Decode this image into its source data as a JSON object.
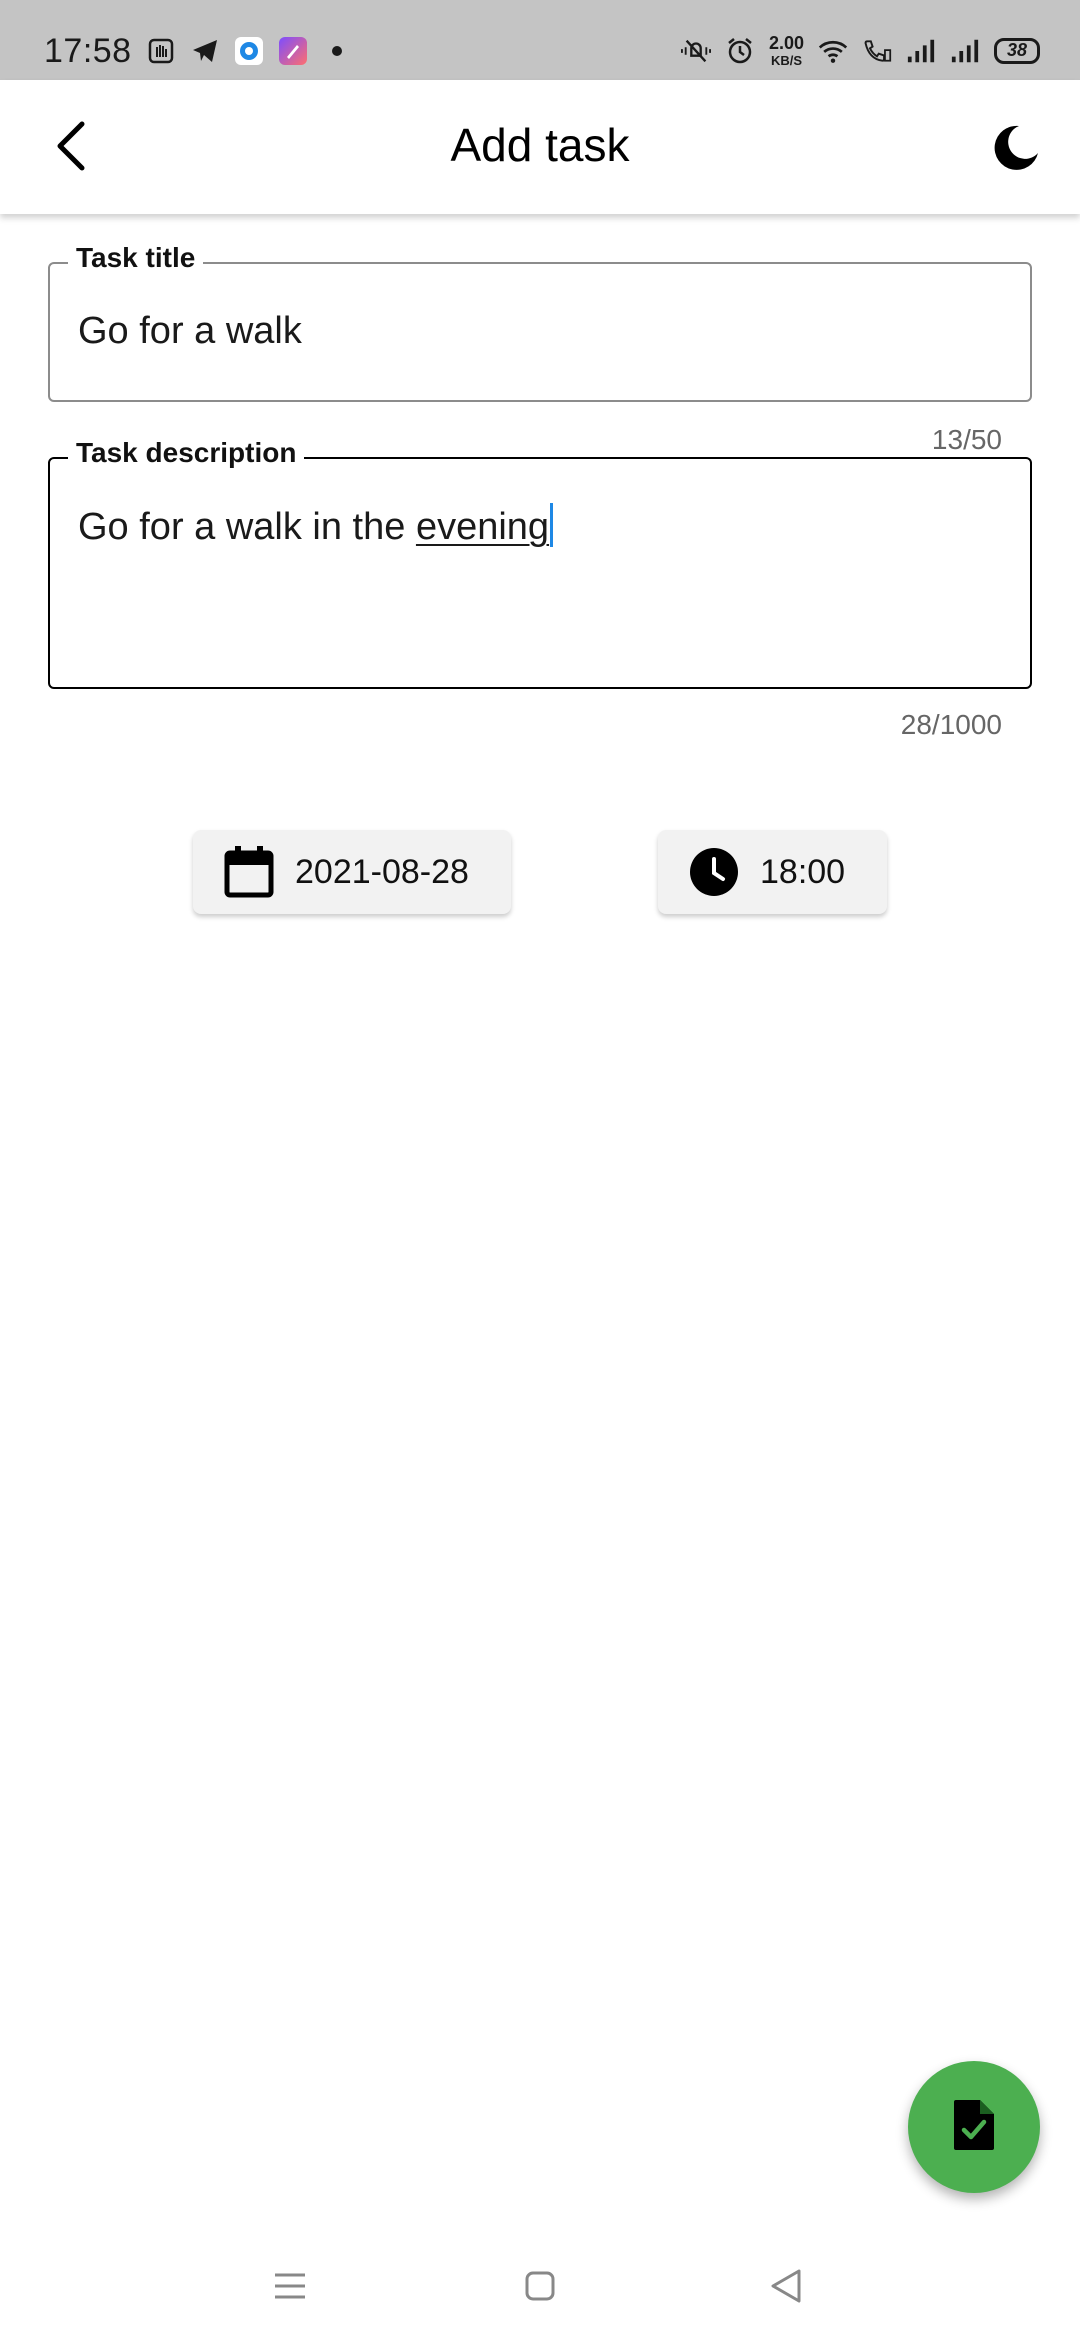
{
  "status_bar": {
    "time": "17:58",
    "speed_value": "2.00",
    "speed_unit": "KB/S",
    "battery": "38"
  },
  "header": {
    "title": "Add task",
    "back_icon": "chevron-left-icon",
    "theme_icon": "moon-icon"
  },
  "form": {
    "title_label": "Task title",
    "title_value": "Go for a walk",
    "title_counter": "13/50",
    "desc_label": "Task description",
    "desc_value_plain": "Go for a walk in the ",
    "desc_value_composing": "evening",
    "desc_counter": "28/1000"
  },
  "schedule": {
    "date": "2021-08-28",
    "time": "18:00"
  },
  "fab": {
    "icon": "file-check-icon",
    "color": "#4caf50"
  },
  "colors": {
    "status_bar_bg": "#c4c4c4",
    "cursor": "#1e88e5",
    "fab": "#4caf50"
  }
}
